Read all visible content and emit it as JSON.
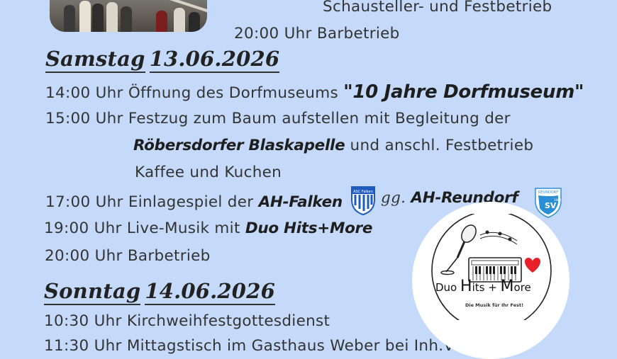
{
  "top": {
    "line1": "Schausteller- und Festbetrieb",
    "line2": "20:00 Uhr Barbetrieb"
  },
  "saturday": {
    "heading_day": "Samstag",
    "heading_date": "13.06.2026",
    "l1_time": "14:00 Uhr Öffnung des Dorfmuseums",
    "l1_quote": "\"10 Jahre Dorfmuseum\"",
    "l2": "15:00 Uhr Festzug zum Baum aufstellen mit Begleitung der",
    "l3_band": "Röbersdorfer Blaskapelle",
    "l3_rest": "und anschl. Festbetrieb",
    "l4": "Kaffee und Kuchen",
    "l5_pre": "17:00 Uhr Einlagespiel der",
    "l5_team1": "AH-Falken",
    "l5_vs": "gg.",
    "l5_team2": "AH-Reundorf",
    "l6_pre": "19:00 Uhr Live-Musik mit",
    "l6_band": "Duo Hits+More",
    "l7": "20:00 Uhr Barbetrieb"
  },
  "sunday": {
    "heading_day": "Sonntag",
    "heading_date": "14.06.2026",
    "l1": "10:30 Uhr Kirchweihfestgottesdienst",
    "l2": "11:30 Uhr Mittagstisch im Gasthaus Weber bei Inh.Vinh"
  },
  "crests": {
    "falken_text": "ASC Falken",
    "reundorf_text": "REUNDORF",
    "reundorf_year": "1960",
    "reundorf_letters": "SV"
  },
  "logo": {
    "title_pre": "Duo ",
    "title_h": "H",
    "title_mid": "its + ",
    "title_m": "M",
    "title_post": "ore",
    "subtitle": "Die Musik für Ihr Fest!"
  },
  "colors": {
    "background": "#c5dafa",
    "heart": "#e8202a",
    "falken_blue": "#1d5bbf",
    "reundorf_blue": "#2b8fd6"
  }
}
